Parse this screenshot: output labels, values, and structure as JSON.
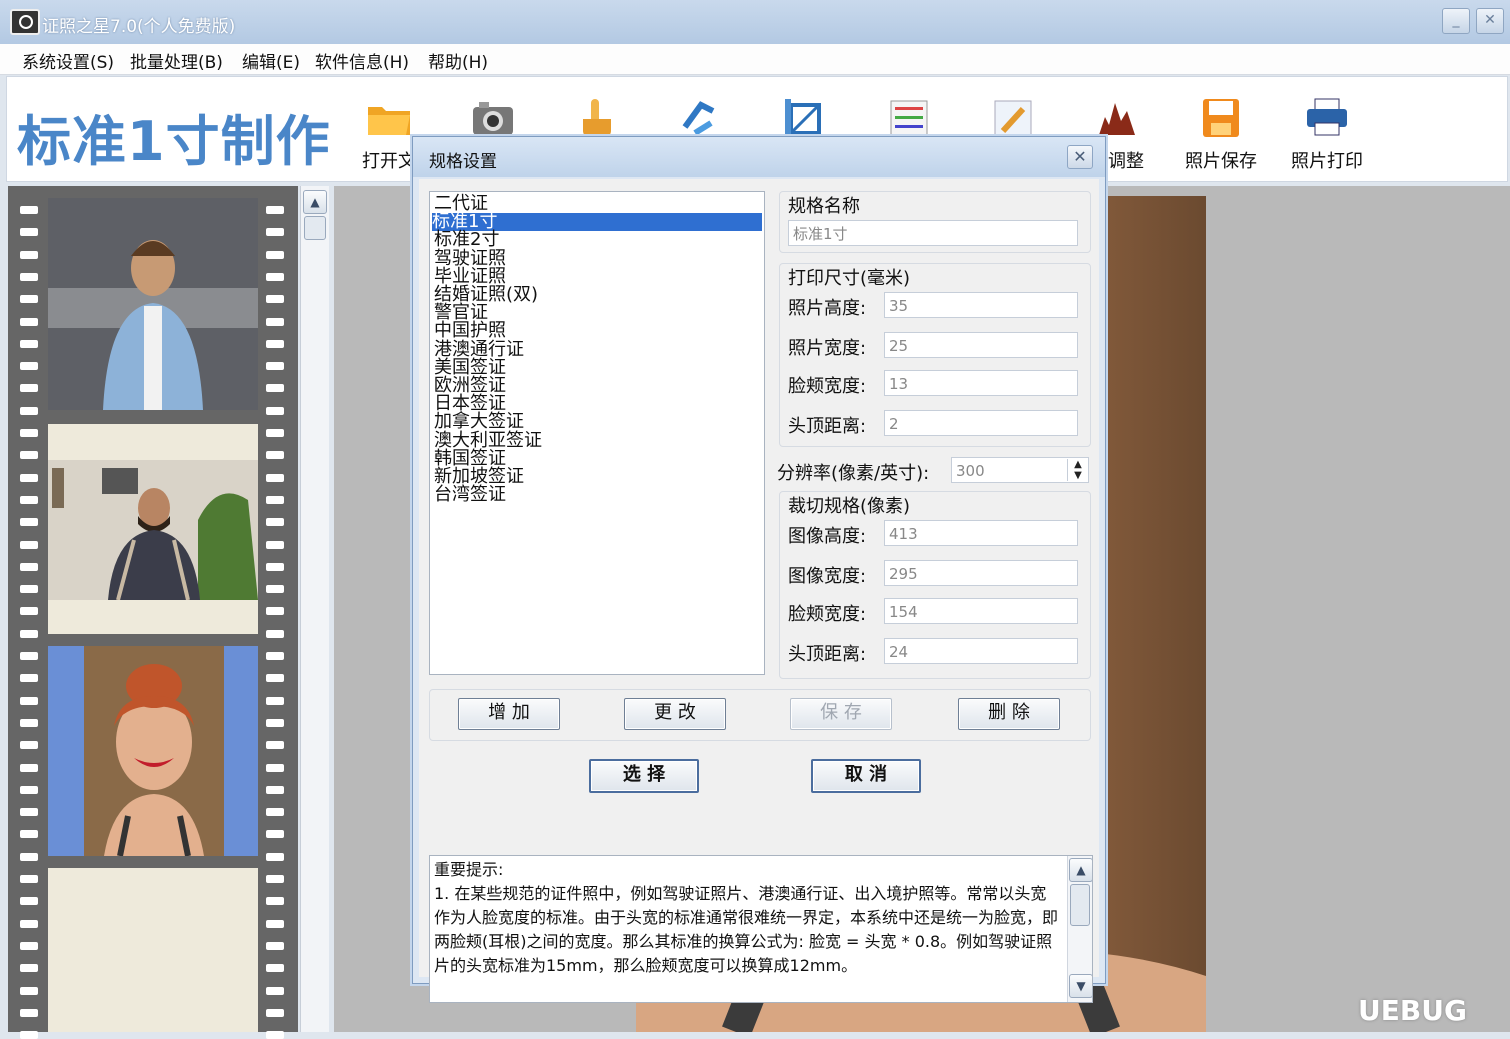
{
  "window": {
    "title": "证照之星7.0(个人免费版)",
    "minimize": "_",
    "close": "✕"
  },
  "menu": [
    "系统设置(S)",
    "批量处理(B)",
    "编辑(E)",
    "软件信息(H)",
    "帮助(H)"
  ],
  "toolbar": {
    "brand": "标准1寸制作",
    "tools": [
      {
        "label": "打开文",
        "icon": "folder-icon"
      },
      {
        "label": "",
        "icon": "camera-icon"
      },
      {
        "label": "",
        "icon": "hand-pointer-icon"
      },
      {
        "label": "",
        "icon": "rotate-icon"
      },
      {
        "label": "",
        "icon": "crop-icon"
      },
      {
        "label": "",
        "icon": "levels-icon"
      },
      {
        "label": "",
        "icon": "brush-icon"
      },
      {
        "label": "节调整",
        "icon": "histogram-icon"
      },
      {
        "label": "照片保存",
        "icon": "save-icon"
      },
      {
        "label": "照片打印",
        "icon": "printer-icon"
      }
    ]
  },
  "dialog": {
    "title": "规格设置",
    "close": "✕",
    "specs": [
      "二代证",
      "标准1寸",
      "标准2寸",
      "驾驶证照",
      "毕业证照",
      "结婚证照(双)",
      "警官证",
      "中国护照",
      "港澳通行证",
      "美国签证",
      "欧洲签证",
      "日本签证",
      "加拿大签证",
      "澳大利亚签证",
      "韩国签证",
      "新加坡签证",
      "台湾签证"
    ],
    "selected_index": 1,
    "name_label": "规格名称",
    "name_value": "标准1寸",
    "print_size_label": "打印尺寸(毫米)",
    "print_fields": [
      {
        "label": "照片高度:",
        "value": "35"
      },
      {
        "label": "照片宽度:",
        "value": "25"
      },
      {
        "label": "脸颊宽度:",
        "value": "13"
      },
      {
        "label": "头顶距离:",
        "value": "2"
      }
    ],
    "resolution_label": "分辨率(像素/英寸):",
    "resolution_value": "300",
    "crop_label": "裁切规格(像素)",
    "crop_fields": [
      {
        "label": "图像高度:",
        "value": "413"
      },
      {
        "label": "图像宽度:",
        "value": "295"
      },
      {
        "label": "脸颊宽度:",
        "value": "154"
      },
      {
        "label": "头顶距离:",
        "value": "24"
      }
    ],
    "buttons": {
      "add": "增 加",
      "change": "更 改",
      "save": "保 存",
      "delete": "删 除",
      "select": "选 择",
      "cancel": "取 消"
    },
    "notes": "重要提示:\n1. 在某些规范的证件照中，例如驾驶证照片、港澳通行证、出入境护照等。常常以头宽作为人脸宽度的标准。由于头宽的标准通常很难统一界定，本系统中还是统一为脸宽，即两脸颊(耳根)之间的宽度。那么其标准的换算公式为: 脸宽 = 头宽 * 0.8。例如驾驶证照片的头宽标准为15mm，那么脸颊宽度可以换算成12mm。"
  },
  "watermark": "UEBUG",
  "colors": {
    "accent": "#4a86c8",
    "selection": "#2f6fd1"
  }
}
